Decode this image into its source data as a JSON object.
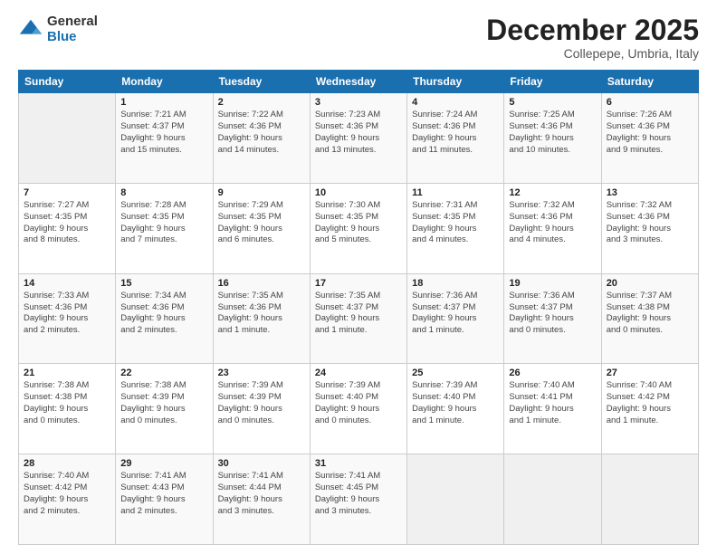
{
  "logo": {
    "general": "General",
    "blue": "Blue"
  },
  "header": {
    "month": "December 2025",
    "location": "Collepepe, Umbria, Italy"
  },
  "days_of_week": [
    "Sunday",
    "Monday",
    "Tuesday",
    "Wednesday",
    "Thursday",
    "Friday",
    "Saturday"
  ],
  "weeks": [
    [
      {
        "day": "",
        "info": ""
      },
      {
        "day": "1",
        "info": "Sunrise: 7:21 AM\nSunset: 4:37 PM\nDaylight: 9 hours\nand 15 minutes."
      },
      {
        "day": "2",
        "info": "Sunrise: 7:22 AM\nSunset: 4:36 PM\nDaylight: 9 hours\nand 14 minutes."
      },
      {
        "day": "3",
        "info": "Sunrise: 7:23 AM\nSunset: 4:36 PM\nDaylight: 9 hours\nand 13 minutes."
      },
      {
        "day": "4",
        "info": "Sunrise: 7:24 AM\nSunset: 4:36 PM\nDaylight: 9 hours\nand 11 minutes."
      },
      {
        "day": "5",
        "info": "Sunrise: 7:25 AM\nSunset: 4:36 PM\nDaylight: 9 hours\nand 10 minutes."
      },
      {
        "day": "6",
        "info": "Sunrise: 7:26 AM\nSunset: 4:36 PM\nDaylight: 9 hours\nand 9 minutes."
      }
    ],
    [
      {
        "day": "7",
        "info": "Sunrise: 7:27 AM\nSunset: 4:35 PM\nDaylight: 9 hours\nand 8 minutes."
      },
      {
        "day": "8",
        "info": "Sunrise: 7:28 AM\nSunset: 4:35 PM\nDaylight: 9 hours\nand 7 minutes."
      },
      {
        "day": "9",
        "info": "Sunrise: 7:29 AM\nSunset: 4:35 PM\nDaylight: 9 hours\nand 6 minutes."
      },
      {
        "day": "10",
        "info": "Sunrise: 7:30 AM\nSunset: 4:35 PM\nDaylight: 9 hours\nand 5 minutes."
      },
      {
        "day": "11",
        "info": "Sunrise: 7:31 AM\nSunset: 4:35 PM\nDaylight: 9 hours\nand 4 minutes."
      },
      {
        "day": "12",
        "info": "Sunrise: 7:32 AM\nSunset: 4:36 PM\nDaylight: 9 hours\nand 4 minutes."
      },
      {
        "day": "13",
        "info": "Sunrise: 7:32 AM\nSunset: 4:36 PM\nDaylight: 9 hours\nand 3 minutes."
      }
    ],
    [
      {
        "day": "14",
        "info": "Sunrise: 7:33 AM\nSunset: 4:36 PM\nDaylight: 9 hours\nand 2 minutes."
      },
      {
        "day": "15",
        "info": "Sunrise: 7:34 AM\nSunset: 4:36 PM\nDaylight: 9 hours\nand 2 minutes."
      },
      {
        "day": "16",
        "info": "Sunrise: 7:35 AM\nSunset: 4:36 PM\nDaylight: 9 hours\nand 1 minute."
      },
      {
        "day": "17",
        "info": "Sunrise: 7:35 AM\nSunset: 4:37 PM\nDaylight: 9 hours\nand 1 minute."
      },
      {
        "day": "18",
        "info": "Sunrise: 7:36 AM\nSunset: 4:37 PM\nDaylight: 9 hours\nand 1 minute."
      },
      {
        "day": "19",
        "info": "Sunrise: 7:36 AM\nSunset: 4:37 PM\nDaylight: 9 hours\nand 0 minutes."
      },
      {
        "day": "20",
        "info": "Sunrise: 7:37 AM\nSunset: 4:38 PM\nDaylight: 9 hours\nand 0 minutes."
      }
    ],
    [
      {
        "day": "21",
        "info": "Sunrise: 7:38 AM\nSunset: 4:38 PM\nDaylight: 9 hours\nand 0 minutes."
      },
      {
        "day": "22",
        "info": "Sunrise: 7:38 AM\nSunset: 4:39 PM\nDaylight: 9 hours\nand 0 minutes."
      },
      {
        "day": "23",
        "info": "Sunrise: 7:39 AM\nSunset: 4:39 PM\nDaylight: 9 hours\nand 0 minutes."
      },
      {
        "day": "24",
        "info": "Sunrise: 7:39 AM\nSunset: 4:40 PM\nDaylight: 9 hours\nand 0 minutes."
      },
      {
        "day": "25",
        "info": "Sunrise: 7:39 AM\nSunset: 4:40 PM\nDaylight: 9 hours\nand 1 minute."
      },
      {
        "day": "26",
        "info": "Sunrise: 7:40 AM\nSunset: 4:41 PM\nDaylight: 9 hours\nand 1 minute."
      },
      {
        "day": "27",
        "info": "Sunrise: 7:40 AM\nSunset: 4:42 PM\nDaylight: 9 hours\nand 1 minute."
      }
    ],
    [
      {
        "day": "28",
        "info": "Sunrise: 7:40 AM\nSunset: 4:42 PM\nDaylight: 9 hours\nand 2 minutes."
      },
      {
        "day": "29",
        "info": "Sunrise: 7:41 AM\nSunset: 4:43 PM\nDaylight: 9 hours\nand 2 minutes."
      },
      {
        "day": "30",
        "info": "Sunrise: 7:41 AM\nSunset: 4:44 PM\nDaylight: 9 hours\nand 3 minutes."
      },
      {
        "day": "31",
        "info": "Sunrise: 7:41 AM\nSunset: 4:45 PM\nDaylight: 9 hours\nand 3 minutes."
      },
      {
        "day": "",
        "info": ""
      },
      {
        "day": "",
        "info": ""
      },
      {
        "day": "",
        "info": ""
      }
    ]
  ]
}
